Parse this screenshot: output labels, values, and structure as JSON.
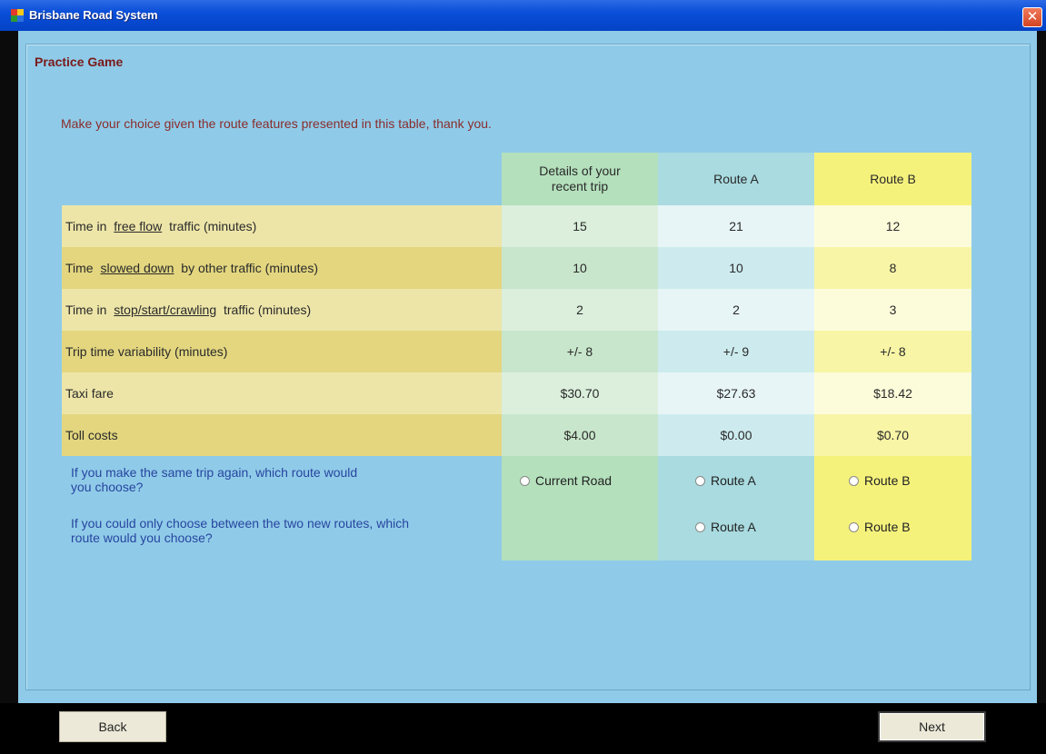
{
  "window": {
    "title": "Brisbane Road System",
    "close_glyph": "✕"
  },
  "group": {
    "label": "Practice Game"
  },
  "intro": "Make your choice given the route features presented in this table, thank you.",
  "table": {
    "headers": {
      "current": "Details of your recent trip",
      "route_a": "Route A",
      "route_b": "Route B"
    },
    "rows": [
      {
        "pre": "Time in ",
        "underlined": "free flow",
        "post": " traffic (minutes)",
        "current": "15",
        "route_a": "21",
        "route_b": "12"
      },
      {
        "pre": "Time ",
        "underlined": "slowed down",
        "post": " by other traffic (minutes)",
        "current": "10",
        "route_a": "10",
        "route_b": "8"
      },
      {
        "pre": "Time in ",
        "underlined": "stop/start/crawling",
        "post": " traffic (minutes)",
        "current": "2",
        "route_a": "2",
        "route_b": "3"
      },
      {
        "pre": "Trip time variability (minutes)",
        "underlined": "",
        "post": "",
        "current": "+/- 8",
        "route_a": "+/- 9",
        "route_b": "+/- 8"
      },
      {
        "pre": "Taxi fare",
        "underlined": "",
        "post": "",
        "current": "$30.70",
        "route_a": "$27.63",
        "route_b": "$18.42"
      },
      {
        "pre": "Toll costs",
        "underlined": "",
        "post": "",
        "current": "$4.00",
        "route_a": "$0.00",
        "route_b": "$0.70"
      }
    ],
    "colors": {
      "label_light": "#ede5a8",
      "label_dark": "#e3d67f",
      "current_header": "#b4e0bc",
      "current_light": "#dbefdc",
      "current_dark": "#c8e6cb",
      "route_a_header": "#a9dbe0",
      "route_a_light": "#e7f5f7",
      "route_a_dark": "#cdebee",
      "route_b_header": "#f5f27c",
      "route_b_light": "#fdfcda",
      "route_b_dark": "#f8f5a6"
    }
  },
  "questions": {
    "q1": {
      "text": "If you make the same trip again, which route would you choose?",
      "opt_current": "Current Road",
      "opt_a": "Route A",
      "opt_b": "Route B"
    },
    "q2": {
      "text": "If you could only choose between the two new routes, which route would you choose?",
      "opt_a": "Route A",
      "opt_b": "Route B"
    }
  },
  "buttons": {
    "back": "Back",
    "next": "Next"
  }
}
